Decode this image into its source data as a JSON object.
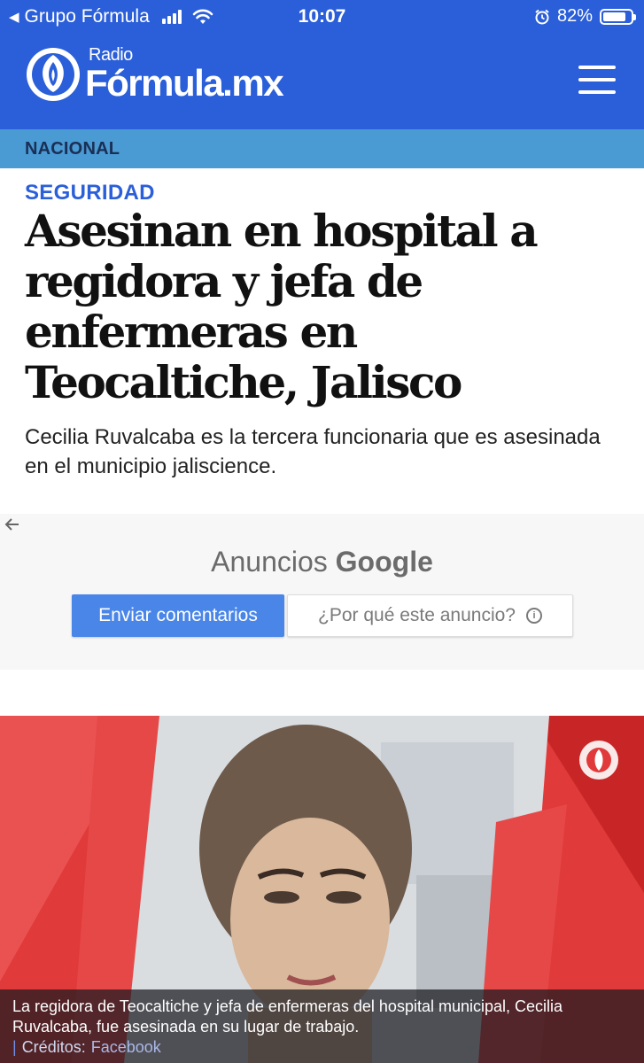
{
  "status_bar": {
    "back_app": "Grupo Fórmula",
    "time": "10:07",
    "battery": "82%",
    "battery_level": 0.82
  },
  "header": {
    "logo_small": "Radio",
    "logo_main": "Fórmula.mx",
    "menu_icon": "hamburger-menu-icon"
  },
  "section": {
    "label": "NACIONAL"
  },
  "article": {
    "kicker": "SEGURIDAD",
    "headline": "Asesinan en hospital a regidora y jefa de enfermeras en Teocaltiche, Jalisco",
    "dek": "Cecilia Ruvalcaba es la tercera funcionaria que es asesinada en el municipio jaliscience."
  },
  "ad": {
    "title_prefix": "Anuncios",
    "title_brand": "Google",
    "feedback_button": "Enviar comentarios",
    "why_button": "¿Por qué este anuncio?"
  },
  "photo": {
    "caption": "La regidora de Teocaltiche y jefa de enfermeras del hospital municipal, Cecilia Ruvalcaba, fue asesinada en su lugar de trabajo.",
    "credit_label": "Créditos:",
    "credit_source": "Facebook"
  },
  "colors": {
    "brand_blue": "#2b5fd9",
    "section_blue": "#4a9ad4",
    "ad_button_blue": "#4a86e8",
    "photo_red": "#e03a3a"
  }
}
